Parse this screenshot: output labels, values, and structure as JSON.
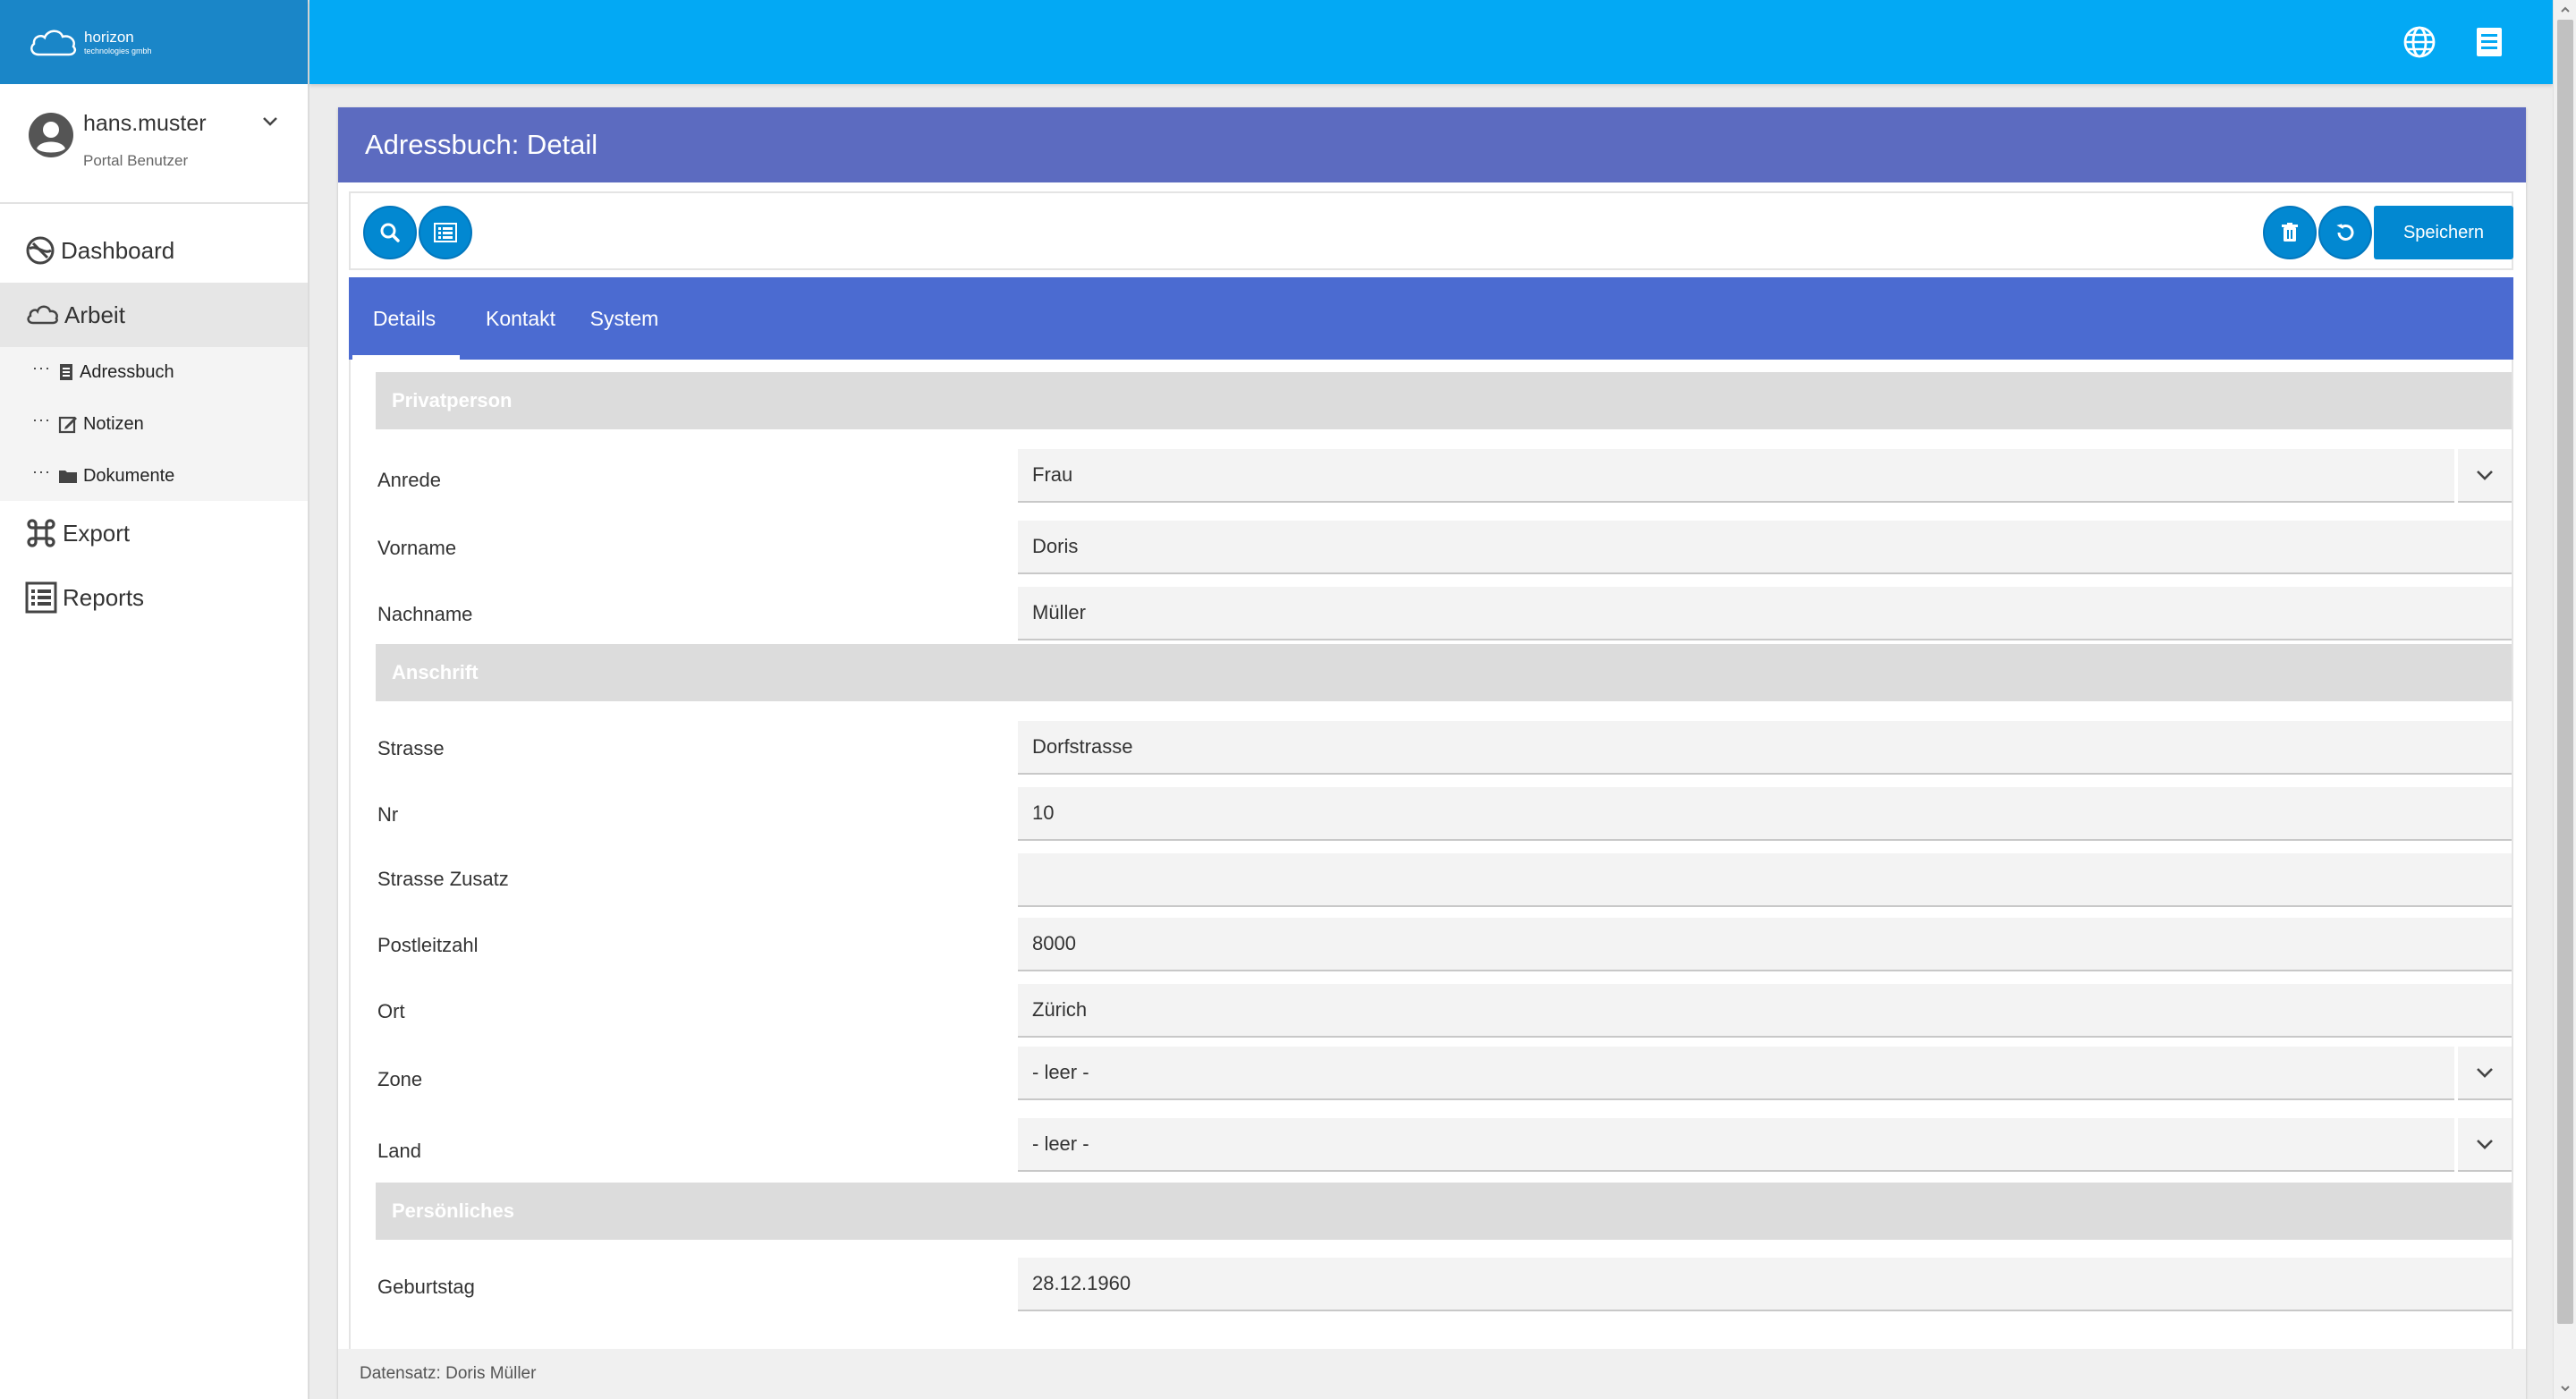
{
  "logo": {
    "title": "horizon",
    "subtitle": "technologies gmbh"
  },
  "user": {
    "name": "hans.muster",
    "role": "Portal Benutzer"
  },
  "nav": {
    "dashboard": "Dashboard",
    "arbeit": "Arbeit",
    "adressbuch": "Adressbuch",
    "notizen": "Notizen",
    "dokumente": "Dokumente",
    "export": "Export",
    "reports": "Reports"
  },
  "panel": {
    "title": "Adressbuch: Detail"
  },
  "toolbar": {
    "save_label": "Speichern"
  },
  "tabs": [
    "Details",
    "Kontakt",
    "System"
  ],
  "sections": {
    "privat": "Privatperson",
    "anschrift": "Anschrift",
    "persoenlich": "Persönliches"
  },
  "fields": {
    "anrede": {
      "label": "Anrede",
      "value": "Frau"
    },
    "vorname": {
      "label": "Vorname",
      "value": "Doris"
    },
    "nachname": {
      "label": "Nachname",
      "value": "Müller"
    },
    "strasse": {
      "label": "Strasse",
      "value": "Dorfstrasse"
    },
    "nr": {
      "label": "Nr",
      "value": "10"
    },
    "zusatz": {
      "label": "Strasse Zusatz",
      "value": ""
    },
    "plz": {
      "label": "Postleitzahl",
      "value": "8000"
    },
    "ort": {
      "label": "Ort",
      "value": "Zürich"
    },
    "zone": {
      "label": "Zone",
      "value": "- leer -"
    },
    "land": {
      "label": "Land",
      "value": "- leer -"
    },
    "geburtstag": {
      "label": "Geburtstag",
      "value": "28.12.1960"
    }
  },
  "footer": {
    "text": "Datensatz: Doris Müller"
  },
  "colors": {
    "topbar": "#03a9f4",
    "logo_bg": "#1a86c8",
    "panel_header": "#5c6bc0",
    "tabs": "#4b6bd1",
    "button": "#0288d1"
  },
  "icons": [
    "cloud-logo-icon",
    "account-circle-icon",
    "chevron-down-icon",
    "dashboard-icon",
    "cloud-icon",
    "book-icon",
    "edit-icon",
    "folder-icon",
    "command-icon",
    "list-icon",
    "globe-icon",
    "notes-icon",
    "search-icon",
    "trash-icon",
    "undo-icon"
  ]
}
